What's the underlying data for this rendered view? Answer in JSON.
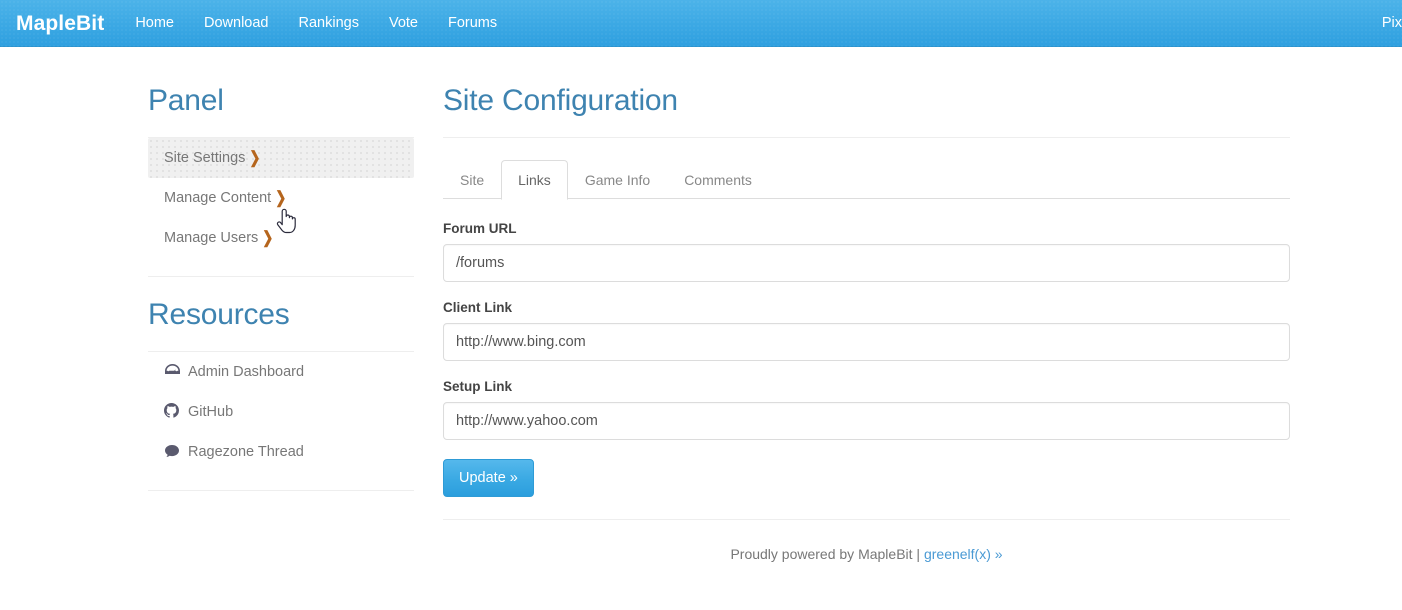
{
  "navbar": {
    "brand": "MapleBit",
    "links": [
      {
        "label": "Home"
      },
      {
        "label": "Download"
      },
      {
        "label": "Rankings"
      },
      {
        "label": "Vote"
      },
      {
        "label": "Forums"
      }
    ],
    "right_label": "Pix",
    "background_color": "#3ba8e4"
  },
  "sidebar": {
    "panel": {
      "heading": "Panel",
      "items": [
        {
          "label": "Site Settings",
          "chevron": "❯",
          "active": true
        },
        {
          "label": "Manage Content",
          "chevron": "❯",
          "active": false
        },
        {
          "label": "Manage Users",
          "chevron": "❯",
          "active": false
        }
      ]
    },
    "resources": {
      "heading": "Resources",
      "items": [
        {
          "label": "Admin Dashboard",
          "icon": "dashboard-icon"
        },
        {
          "label": "GitHub",
          "icon": "github-icon"
        },
        {
          "label": "Ragezone Thread",
          "icon": "comment-icon"
        }
      ]
    }
  },
  "main": {
    "title": "Site Configuration",
    "tabs": [
      {
        "label": "Site",
        "active": false
      },
      {
        "label": "Links",
        "active": true
      },
      {
        "label": "Game Info",
        "active": false
      },
      {
        "label": "Comments",
        "active": false
      }
    ],
    "fields": [
      {
        "label": "Forum URL",
        "value": "/forums",
        "placeholder": "/forums"
      },
      {
        "label": "Client Link",
        "value": "http://www.bing.com",
        "placeholder": "http://www.bing.com"
      },
      {
        "label": "Setup Link",
        "value": "http://www.yahoo.com",
        "placeholder": "http://www.yahoo.com"
      }
    ],
    "submit_label": "Update »"
  },
  "footer": {
    "text": "Proudly powered by MapleBit | ",
    "link_label": "greenelf(x) »"
  },
  "theme": {
    "heading_color": "#3e83b0",
    "accent_blue": "#3ba8e4",
    "chevron_color": "#b5651d",
    "link_color": "#4a9ad4"
  }
}
